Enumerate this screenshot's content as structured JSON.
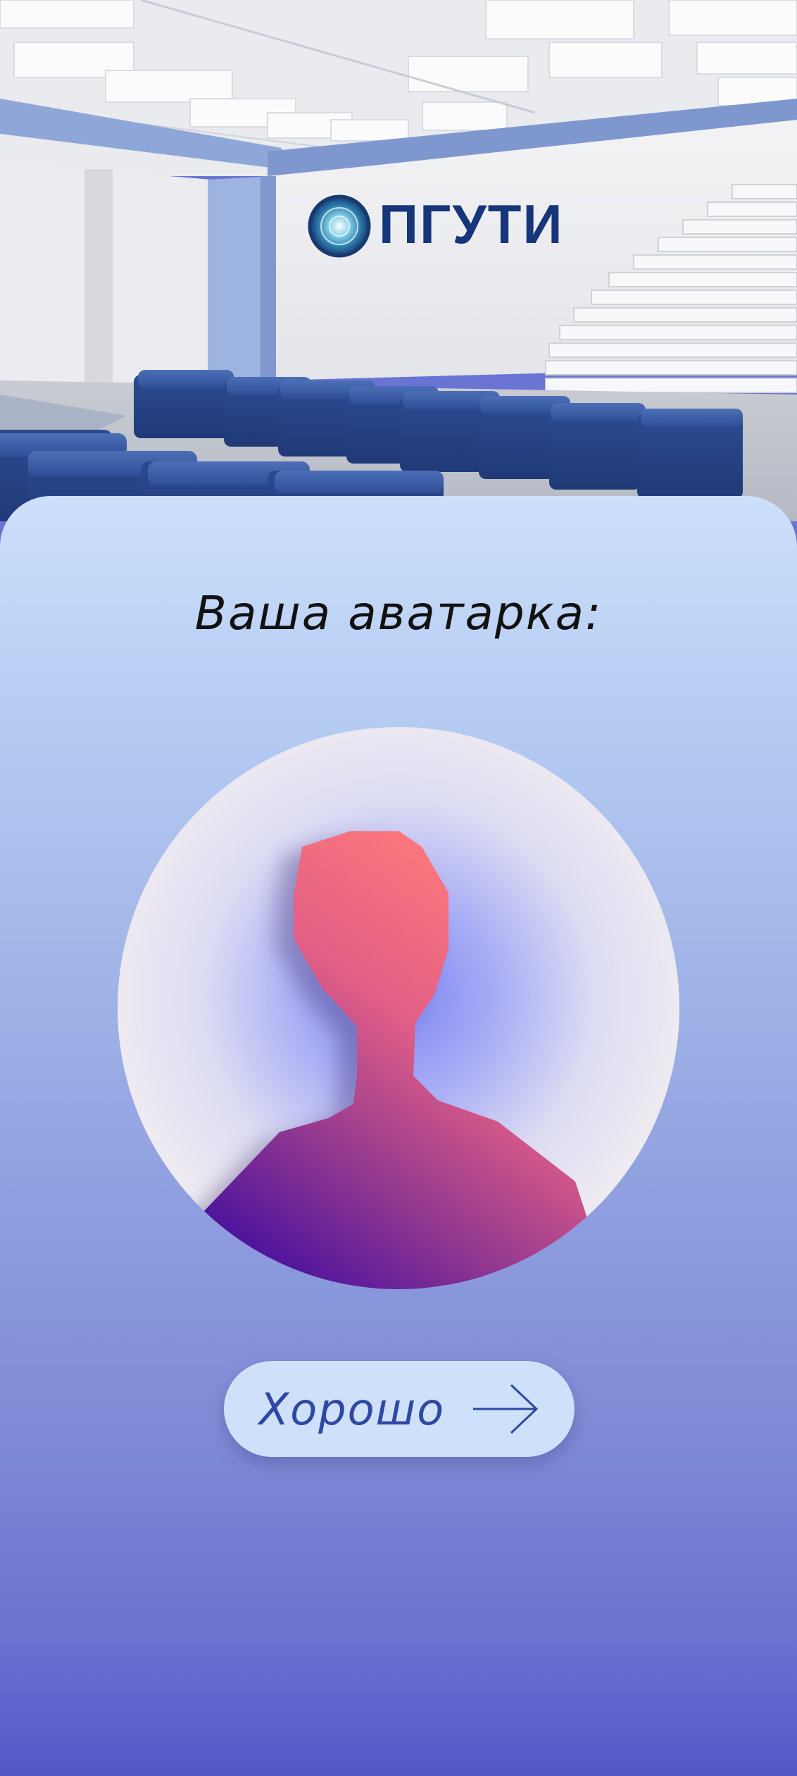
{
  "hero": {
    "logo_text": "ПГУТИ",
    "logo_icon": "university-emblem-icon"
  },
  "card": {
    "title": "Ваша аватарка:",
    "avatar_icon": "person-silhouette-icon",
    "ok_button": {
      "label": "Хорошо",
      "icon": "arrow-right-icon"
    }
  },
  "colors": {
    "card_top": "#cde0fb",
    "card_bottom": "#5257c8",
    "button_bg": "#cfe0fb",
    "button_text": "#2f48a3",
    "silhouette_top": "#ff7a7a",
    "silhouette_bottom": "#3b0aa0"
  }
}
